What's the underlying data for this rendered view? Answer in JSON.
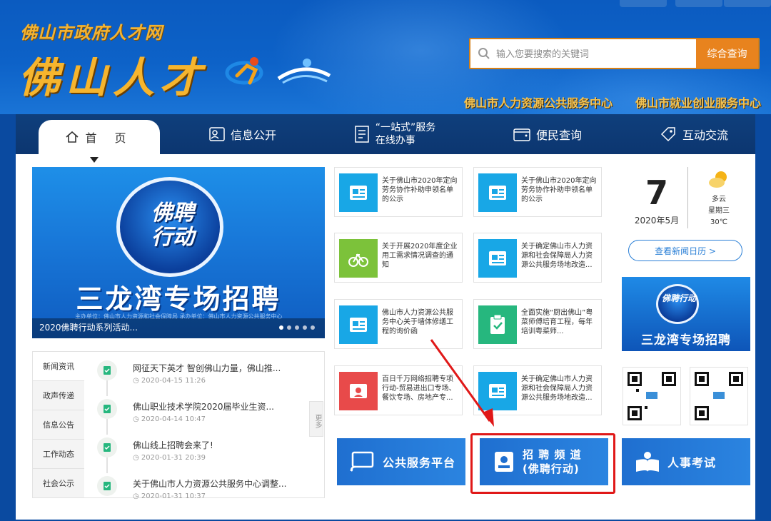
{
  "header": {
    "site_subtitle": "佛山市政府人才网",
    "site_title": "佛山人才",
    "search_placeholder": "输入您要搜索的关键词",
    "search_button": "综合查询",
    "links": [
      "佛山市人力资源公共服务中心",
      "佛山市就业创业服务中心"
    ]
  },
  "nav": {
    "home": "首 页",
    "info": "信息公开",
    "onestop_line1": "“一站式”服务",
    "onestop_line2": "在线办事",
    "query": "便民查询",
    "interact": "互动交流"
  },
  "banner": {
    "badge_line1": "佛聘",
    "badge_line2": "行动",
    "headline": "三龙湾专场招聘",
    "fine_print": "主办单位：佛山市人力资源和社会保障局   承办单位：佛山市人力资源公共服务中心",
    "caption": "2020佛聘行动系列活动..."
  },
  "news": {
    "tabs": [
      "新闻资讯",
      "政声传递",
      "信息公告",
      "工作动态",
      "社会公示"
    ],
    "more": "更多",
    "items": [
      {
        "title": "网征天下英才 智创佛山力量，佛山推...",
        "date": "2020-04-15 11:26"
      },
      {
        "title": "佛山职业技术学院2020届毕业生资...",
        "date": "2020-04-14 10:47"
      },
      {
        "title": "佛山线上招聘会来了!",
        "date": "2020-01-31 20:39"
      },
      {
        "title": "关于佛山市人力资源公共服务中心调整...",
        "date": "2020-01-31 10:37"
      }
    ]
  },
  "cards": [
    {
      "text": "关于佛山市2020年定向劳务协作补助申领名单的公示",
      "color": "#18a7e6",
      "icon": "doc-card-icon"
    },
    {
      "text": "关于佛山市2020年定向劳务协作补助申领名单的公示",
      "color": "#18a7e6",
      "icon": "doc-card-icon"
    },
    {
      "text": "关于开展2020年度企业用工需求情况调查的通知",
      "color": "#7cc23a",
      "icon": "bike-icon"
    },
    {
      "text": "关于确定佛山市人力资源和社会保障局人力资源公共服务场地改造...",
      "color": "#18a7e6",
      "icon": "doc-card-icon"
    },
    {
      "text": "佛山市人力资源公共服务中心关于墙体修缮工程的询价函",
      "color": "#18a7e6",
      "icon": "doc-card-icon"
    },
    {
      "text": "全面实施“厨出佛山”粤菜师傅培育工程，每年培训粤菜师...",
      "color": "#26b77e",
      "icon": "clipboard-icon"
    },
    {
      "text": "百日千万网络招聘专项行动-贸易进出口专场、餐饮专场、房地产专...",
      "color": "#e84a4a",
      "icon": "recruit-icon"
    },
    {
      "text": "关于确定佛山市人力资源和社会保障局人力资源公共服务场地改造...",
      "color": "#18a7e6",
      "icon": "doc-card-icon"
    }
  ],
  "date_widget": {
    "day": "7",
    "month": "2020年5月",
    "weather": "多云",
    "weekday": "星期三",
    "temp": "30℃",
    "calendar_button": "查看新闻日历 >"
  },
  "side_banner": {
    "badge": "佛聘行动",
    "text": "三龙湾专场招聘"
  },
  "bottom_buttons": {
    "public_service": "公共服务平台",
    "recruit_line1": "招 聘 频 道",
    "recruit_line2": "(佛聘行动)",
    "exam": "人事考试"
  },
  "colors": {
    "header_blue": "#0d62c8",
    "nav_dark": "#0f3f7c",
    "search_orange": "#e8831e",
    "title_gold": "#f6b52e",
    "highlight_red": "#e01818"
  }
}
